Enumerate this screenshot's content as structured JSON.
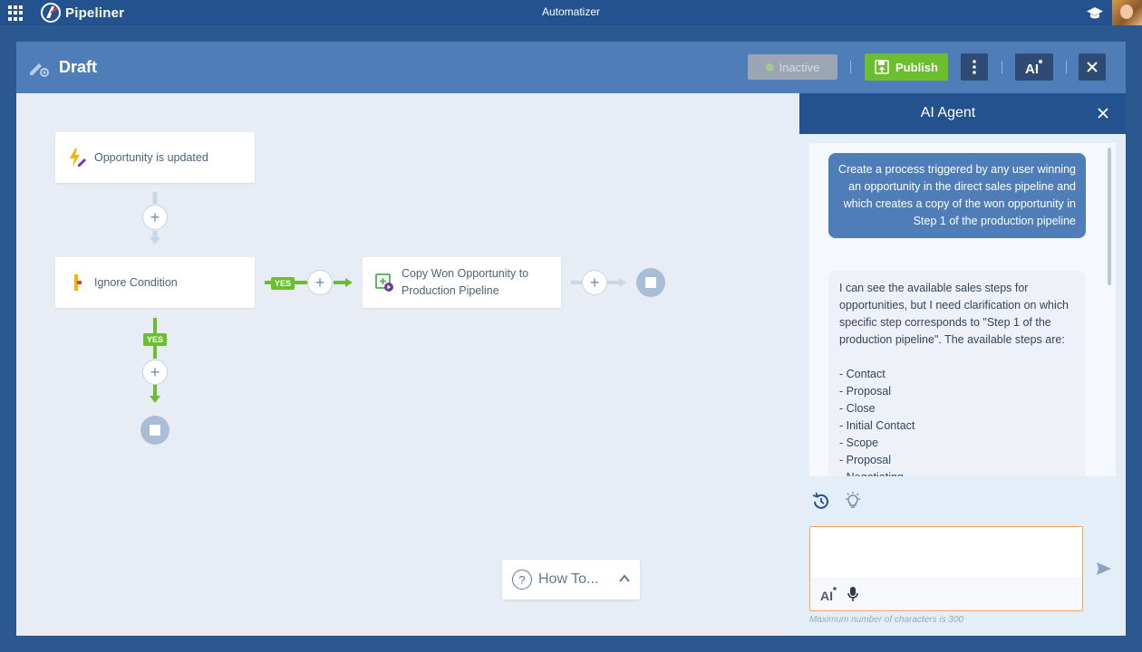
{
  "topbar": {
    "brand": "Pipeliner",
    "app_title": "Automatizer"
  },
  "header": {
    "title": "Draft",
    "inactive_label": "Inactive",
    "publish_label": "Publish"
  },
  "canvas": {
    "nodes": {
      "trigger": "Opportunity is updated",
      "condition": "Ignore Condition",
      "action": "Copy Won Opportunity to Production Pipeline"
    },
    "yes_label": "YES",
    "howto_label": "How To..."
  },
  "ai": {
    "title": "AI Agent",
    "user_message": "Create a process triggered by any user winning an opportunity in the direct sales pipeline and which creates a copy of the won opportunity in Step 1 of the production pipeline",
    "bot_message": "I can see the available sales steps for opportunities, but I need clarification on which specific step corresponds to \"Step 1 of the production pipeline\". The available steps are:\n\n- Contact\n- Proposal\n- Close\n- Initial Contact\n- Scope\n- Proposal\n- Negotiating",
    "input_value": "",
    "max_chars": "Maximum number of characters is 300"
  },
  "colors": {
    "topbar": "#23528f",
    "header": "#4f7db7",
    "publish": "#6cbe2e",
    "canvas": "#e8edf5"
  }
}
